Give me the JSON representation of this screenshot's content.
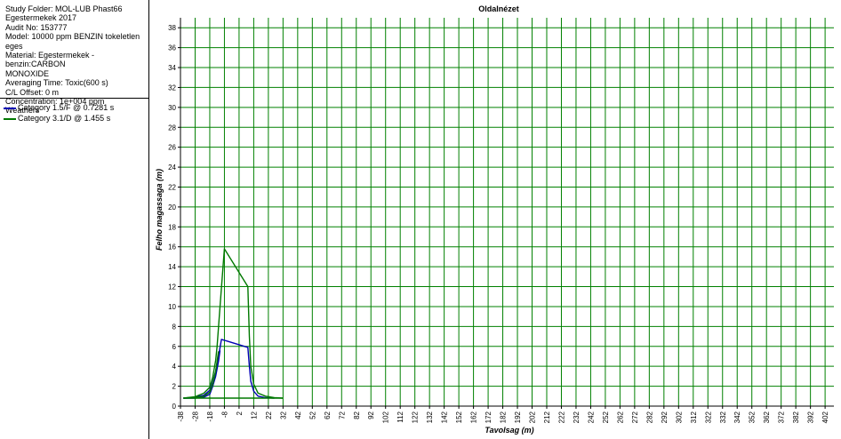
{
  "info": {
    "lines": [
      "Study Folder: MOL-LUB Phast66",
      "Egestermekek 2017",
      "Audit No: 153777",
      "Model: 10000 ppm BENZIN tokeletlen eges",
      "Material: Egestermekek - benzin:CARBON",
      "MONOXIDE",
      "Averaging Time: Toxic(600 s)",
      "C/L Offset: 0 m",
      "Concentration: 1e+004 ppm",
      "Weathers"
    ]
  },
  "legend": [
    {
      "label": "Category 1.5/F @ 0.7281 s",
      "color": "#0000b4"
    },
    {
      "label": "Category 3.1/D @ 1.455 s",
      "color": "#007800"
    }
  ],
  "chart_data": {
    "type": "line",
    "title": "Oldalnézet",
    "xlabel": "Tavolsag (m)",
    "ylabel": "Felho magassaga (m)",
    "xlim": [
      -38,
      408
    ],
    "ylim": [
      0,
      39
    ],
    "x_ticks": [
      -38,
      -28,
      -18,
      -8,
      2,
      12,
      22,
      32,
      42,
      52,
      62,
      72,
      82,
      92,
      102,
      112,
      122,
      132,
      142,
      152,
      162,
      172,
      182,
      192,
      202,
      212,
      222,
      232,
      242,
      252,
      262,
      272,
      282,
      292,
      302,
      312,
      322,
      332,
      342,
      352,
      362,
      372,
      382,
      392,
      402
    ],
    "x_tick_labels": [
      "-38",
      "-28",
      "-18",
      "-8",
      "2",
      "12",
      "22",
      "32",
      "42",
      "52",
      "62",
      "72",
      "82",
      "92",
      "102",
      "112",
      "122",
      "132",
      "142",
      "152",
      "162",
      "172",
      "182",
      "192",
      "202",
      "212",
      "222",
      "232",
      "242",
      "252",
      "262",
      "272",
      "282",
      "292",
      "302",
      "312",
      "322",
      "332",
      "342",
      "352",
      "362",
      "372",
      "382",
      "392",
      "402"
    ],
    "y_ticks": [
      0,
      2,
      4,
      6,
      8,
      10,
      12,
      14,
      16,
      18,
      20,
      22,
      24,
      26,
      28,
      30,
      32,
      34,
      36,
      38
    ],
    "y_tick_labels": [
      "0",
      "2",
      "4",
      "6",
      "8",
      "10",
      "12",
      "14",
      "16",
      "18",
      "20",
      "22",
      "24",
      "26",
      "28",
      "30",
      "32",
      "34",
      "36",
      "38"
    ],
    "grid": true,
    "series": [
      {
        "name": "Category 1.5/F @ 0.7281 s",
        "color": "#0000b4",
        "upper": [
          [
            -36,
            0.8
          ],
          [
            -28,
            0.9
          ],
          [
            -22,
            1.1
          ],
          [
            -18,
            1.6
          ],
          [
            -16,
            2.4
          ],
          [
            -14,
            3.5
          ],
          [
            -12,
            5.0
          ],
          [
            -10,
            6.7
          ],
          [
            8,
            5.9
          ],
          [
            9,
            4.0
          ],
          [
            10,
            2.5
          ],
          [
            12,
            1.5
          ],
          [
            15,
            1.0
          ],
          [
            20,
            0.85
          ],
          [
            26,
            0.8
          ]
        ],
        "lower": [
          [
            -36,
            0.8
          ],
          [
            -28,
            0.8
          ],
          [
            -22,
            0.9
          ],
          [
            -18,
            1.2
          ],
          [
            -16,
            2.0
          ],
          [
            -14,
            3.0
          ],
          [
            -12,
            4.5
          ],
          [
            -11,
            5.6
          ]
        ]
      },
      {
        "name": "Category 3.1/D @ 1.455 s",
        "color": "#007800",
        "upper": [
          [
            -36,
            0.8
          ],
          [
            -28,
            0.95
          ],
          [
            -22,
            1.3
          ],
          [
            -18,
            1.9
          ],
          [
            -16,
            2.9
          ],
          [
            -14,
            4.6
          ],
          [
            -13,
            6.0
          ],
          [
            -11,
            10.0
          ],
          [
            -8,
            15.8
          ],
          [
            8,
            12.0
          ],
          [
            9,
            7.0
          ],
          [
            10,
            4.0
          ],
          [
            12,
            2.2
          ],
          [
            15,
            1.3
          ],
          [
            20,
            1.0
          ],
          [
            26,
            0.85
          ],
          [
            32,
            0.8
          ]
        ],
        "lower": [
          [
            -36,
            0.8
          ],
          [
            -28,
            0.85
          ],
          [
            -22,
            1.0
          ],
          [
            -18,
            1.4
          ],
          [
            -16,
            2.2
          ],
          [
            -14,
            3.5
          ],
          [
            -12,
            5.5
          ]
        ],
        "centerline": [
          [
            -36,
            0.8
          ],
          [
            32,
            0.8
          ]
        ]
      }
    ]
  }
}
